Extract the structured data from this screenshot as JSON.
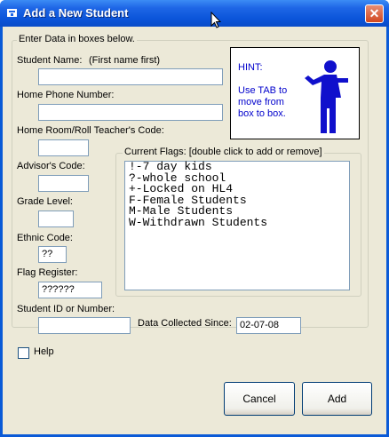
{
  "window": {
    "title": "Add a New Student",
    "close_symbol": "✕",
    "app_icon": "app-icon"
  },
  "form": {
    "group_title": "Enter Data in boxes below.",
    "student_name_label": "Student Name:",
    "student_name_hint": "(First name first)",
    "student_name_value": "",
    "home_phone_label": "Home Phone Number:",
    "home_phone_value": "",
    "home_room_label": "Home Room/Roll Teacher's Code:",
    "home_room_value": "",
    "advisor_label": "Advisor's Code:",
    "advisor_value": "",
    "grade_label": "Grade Level:",
    "grade_value": "",
    "ethnic_label": "Ethnic Code:",
    "ethnic_value": "??",
    "flag_register_label": "Flag Register:",
    "flag_register_value": "??????",
    "student_id_label": "Student ID or Number:",
    "student_id_value": "",
    "data_collected_label": "Data Collected Since:",
    "data_collected_value": "02-07-08",
    "help_label": "Help",
    "help_checked": false
  },
  "hint": {
    "title": "HINT:",
    "body": "Use TAB to move from box to box.",
    "figure_icon": "presenter-figure-icon"
  },
  "flags": {
    "title": "Current Flags: [double click to add or remove]",
    "items": [
      "!-7 day kids",
      "?-whole school",
      "+-Locked on HL4",
      "F-Female Students",
      "M-Male Students",
      "W-Withdrawn Students"
    ]
  },
  "buttons": {
    "cancel": "Cancel",
    "add": "Add"
  },
  "colors": {
    "titlebar": "#0A5AD7",
    "dialog_bg": "#ECE9D8",
    "hint_text": "#0000CC",
    "close_button": "#D1471F"
  }
}
